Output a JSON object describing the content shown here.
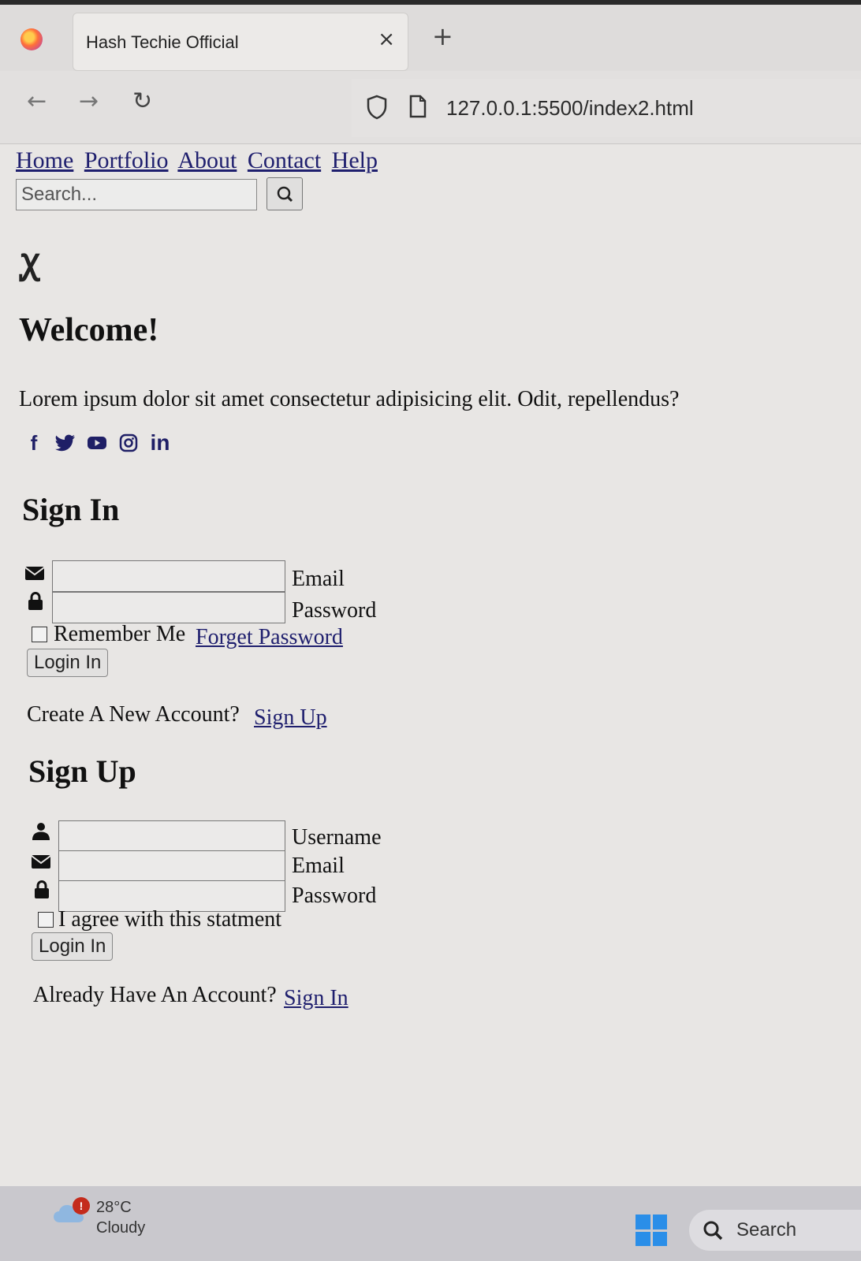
{
  "browser": {
    "tab_title": "Hash Techie Official",
    "tab_close": "×",
    "new_tab": "+",
    "back": "←",
    "forward": "→",
    "reload": "↻",
    "url": "127.0.0.1:5500/index2.html"
  },
  "page": {
    "nav": [
      "Home",
      "Portfolio",
      "About",
      "Contact",
      "Help"
    ],
    "search_placeholder": "Search...",
    "brand_glyph": "ꭕ",
    "welcome_title": "Welcome!",
    "intro": "Lorem ipsum dolor sit amet consectetur adipisicing elit. Odit, repellendus?",
    "socials": [
      "facebook-icon",
      "twitter-icon",
      "youtube-icon",
      "instagram-icon",
      "linkedin-icon"
    ],
    "social_linkedin_text": "in",
    "social_facebook_text": "f",
    "signin": {
      "title": "Sign In",
      "email_label": "Email",
      "password_label": "Password",
      "remember": "Remember Me",
      "forgot": "Forget Password",
      "button": "Login In",
      "prompt": "Create A New Account?",
      "prompt_link": "Sign Up"
    },
    "signup": {
      "title": "Sign Up",
      "username_label": "Username",
      "email_label": "Email",
      "password_label": "Password",
      "agree": "I agree with this statment",
      "button": "Login In",
      "prompt": "Already Have An Account?",
      "prompt_link": "Sign In"
    }
  },
  "taskbar": {
    "weather_temp": "28°C",
    "weather_condition": "Cloudy",
    "badge": "!",
    "search_label": "Search"
  },
  "colors": {
    "link": "#1f1f6e",
    "windows_blue": "#2a8ee8",
    "badge_red": "#c42b1c"
  }
}
